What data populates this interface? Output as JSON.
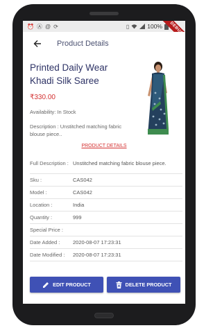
{
  "status_bar": {
    "left_icons": [
      "alarm-icon",
      "notification-a-icon",
      "mail-icon",
      "sync-icon"
    ],
    "right_icons": [
      "vibrate-icon",
      "wifi-icon",
      "signal-icon"
    ],
    "battery": "100%",
    "ribbon": "DEBUG"
  },
  "app_bar": {
    "title": "Product Details",
    "back_icon": "arrow-back-icon"
  },
  "product": {
    "name": "Printed Daily Wear Khadi Silk Saree",
    "price": "₹330.00",
    "availability": "Availability: In Stock",
    "short_description": "Description : Unstitched matching fabric blouse piece.."
  },
  "section_link": "PRODUCT DETAILS",
  "details": {
    "full_description": {
      "label": "Full Description :",
      "value": "Unstitched matching fabric blouse piece."
    },
    "rows": [
      {
        "label": "Sku :",
        "value": "CAS042"
      },
      {
        "label": "Model :",
        "value": "CAS042"
      },
      {
        "label": "Location :",
        "value": "India"
      },
      {
        "label": "Quantity :",
        "value": "999"
      },
      {
        "label": "Special Price :",
        "value": ""
      },
      {
        "label": "Date Added :",
        "value": "2020-08-07 17:23:31"
      },
      {
        "label": "Date Modified :",
        "value": "2020-08-07 17:23:31"
      }
    ]
  },
  "buttons": {
    "edit": "EDIT PRODUCT",
    "delete": "DELETE PRODUCT"
  },
  "colors": {
    "primary": "#3f51b5",
    "title": "#2e3366",
    "price": "#d32f2f"
  }
}
